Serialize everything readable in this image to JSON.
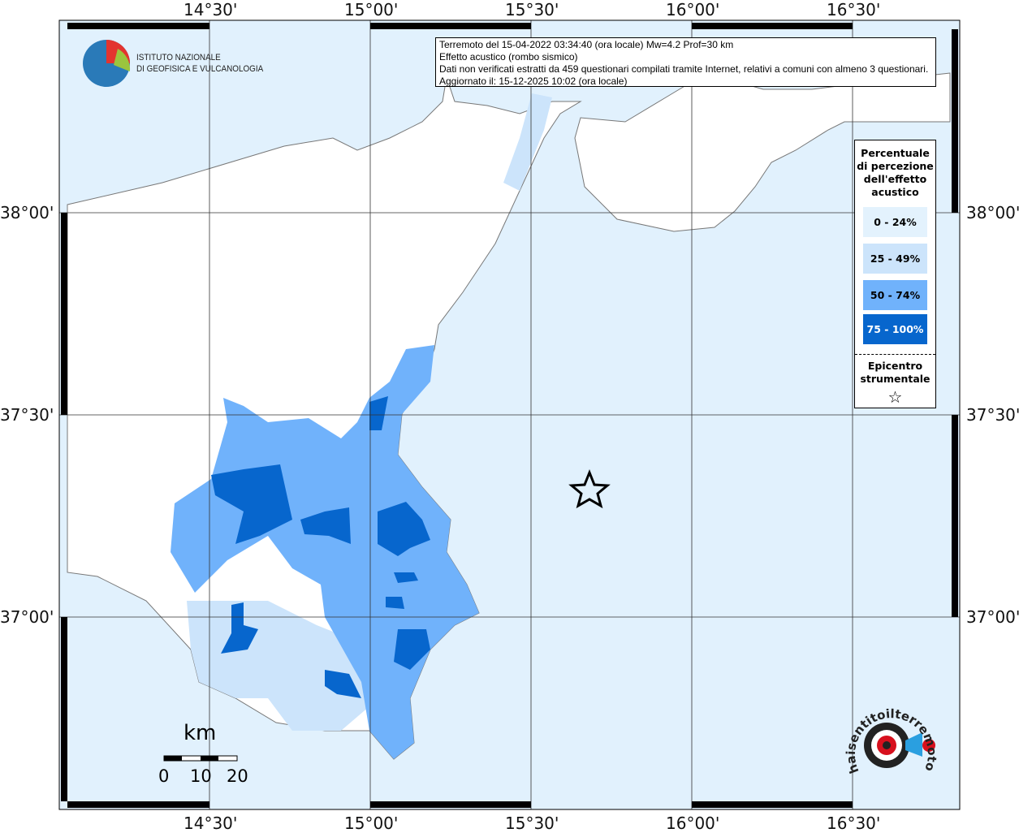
{
  "info": {
    "line1": "Terremoto del 15-04-2022 03:34:40 (ora locale) Mw=4.2 Prof=30 km",
    "line2": "Effetto acustico (rombo sismico)",
    "line3": "Dati non verificati estratti da 459 questionari compilati tramite Internet, relativi a comuni con almeno 3 questionari.",
    "line4": "Aggiornato il: 15-12-2025 10:02 (ora locale)"
  },
  "logo": {
    "line1": "ISTITUTO NAZIONALE",
    "line2": "DI GEOFISICA E VULCANOLOGIA"
  },
  "axes": {
    "lon": [
      "14°30'",
      "15°00'",
      "15°30'",
      "16°00'",
      "16°30'"
    ],
    "lat": [
      "38°00'",
      "37°30'",
      "37°00'"
    ]
  },
  "legend": {
    "title": "Percentuale di percezione dell'effetto acustico",
    "classes": [
      {
        "label": "0 - 24%",
        "color": "#e3f2fd"
      },
      {
        "label": "25 - 49%",
        "color": "#cce4fb"
      },
      {
        "label": "50 - 74%",
        "color": "#70b2fb"
      },
      {
        "label": "75 - 100%",
        "color": "#0766cd"
      }
    ],
    "epicenter": "Epicentro strumentale",
    "star": "☆"
  },
  "scale": {
    "unit": "km",
    "labels": [
      "0",
      "10",
      "20"
    ]
  },
  "watermark": "haisentitoilterremoto.it www"
}
